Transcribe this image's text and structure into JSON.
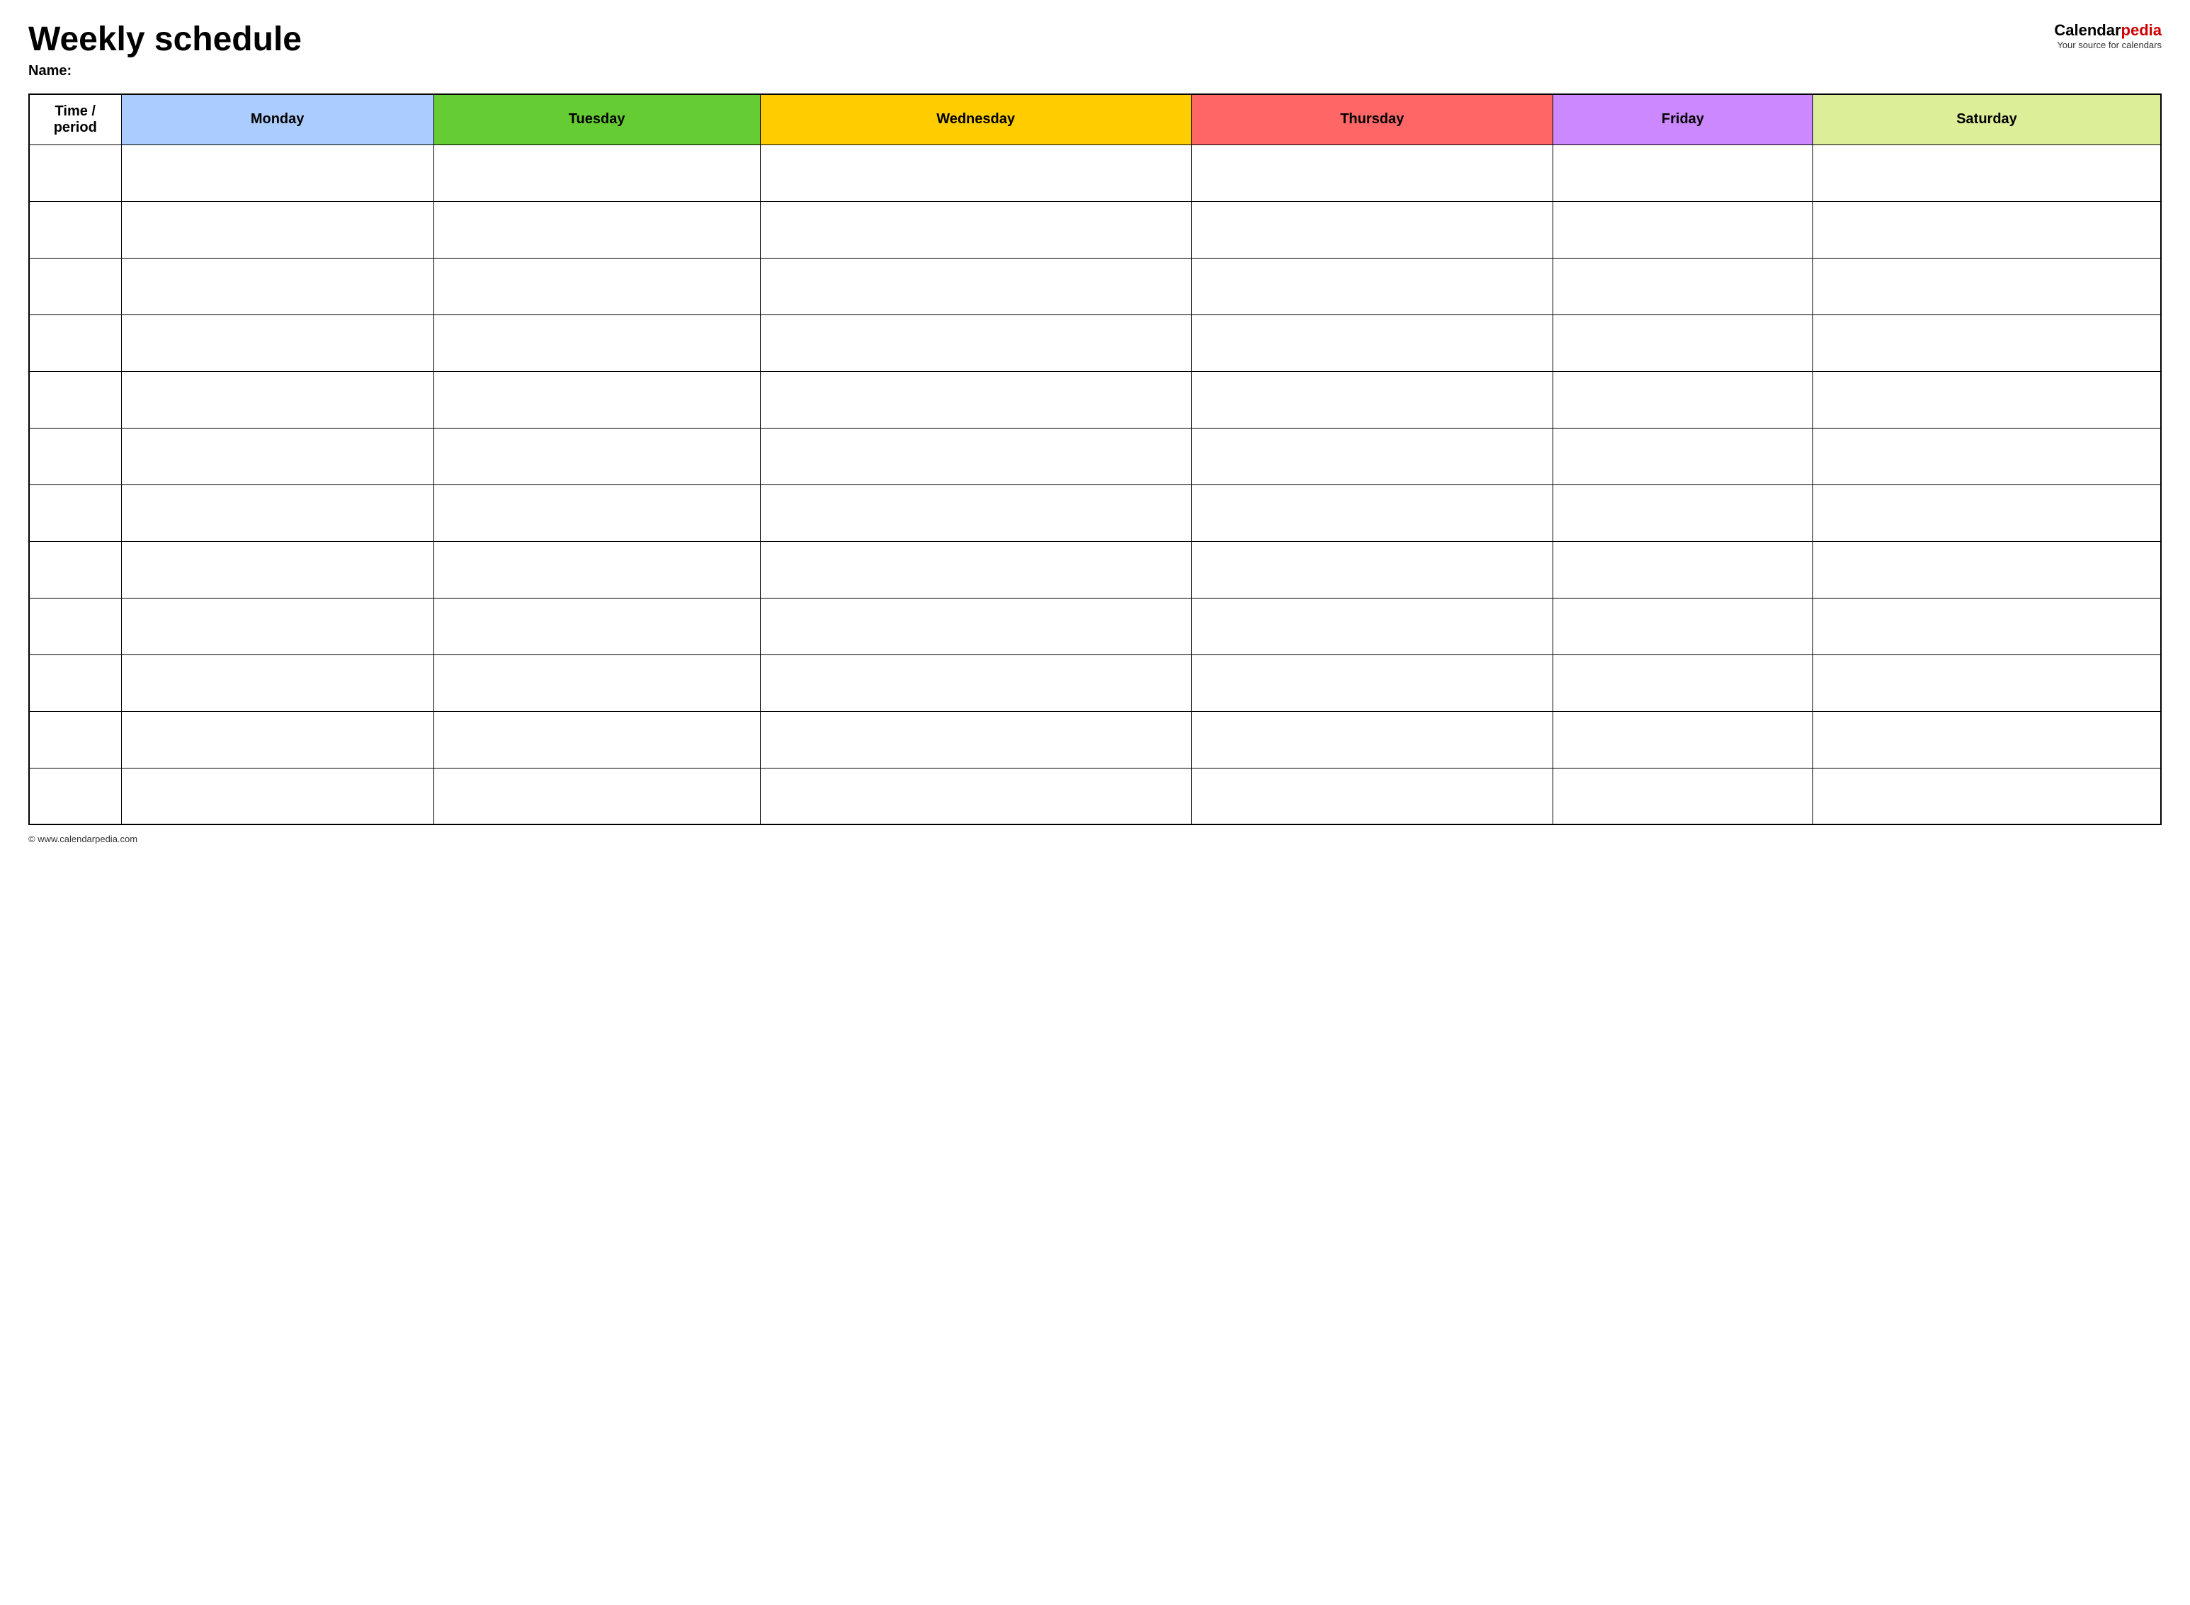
{
  "header": {
    "title": "Weekly schedule",
    "name_label": "Name:",
    "logo": {
      "brand_calendar": "Calendar",
      "brand_pedia": "pedia",
      "subtitle": "Your source for calendars"
    }
  },
  "table": {
    "columns": [
      {
        "key": "time",
        "label": "Time / period",
        "class": "th-time"
      },
      {
        "key": "monday",
        "label": "Monday",
        "class": "th-monday"
      },
      {
        "key": "tuesday",
        "label": "Tuesday",
        "class": "th-tuesday"
      },
      {
        "key": "wednesday",
        "label": "Wednesday",
        "class": "th-wednesday"
      },
      {
        "key": "thursday",
        "label": "Thursday",
        "class": "th-thursday"
      },
      {
        "key": "friday",
        "label": "Friday",
        "class": "th-friday"
      },
      {
        "key": "saturday",
        "label": "Saturday",
        "class": "th-saturday"
      }
    ],
    "row_count": 12
  },
  "footer": {
    "url": "© www.calendarpedia.com"
  }
}
